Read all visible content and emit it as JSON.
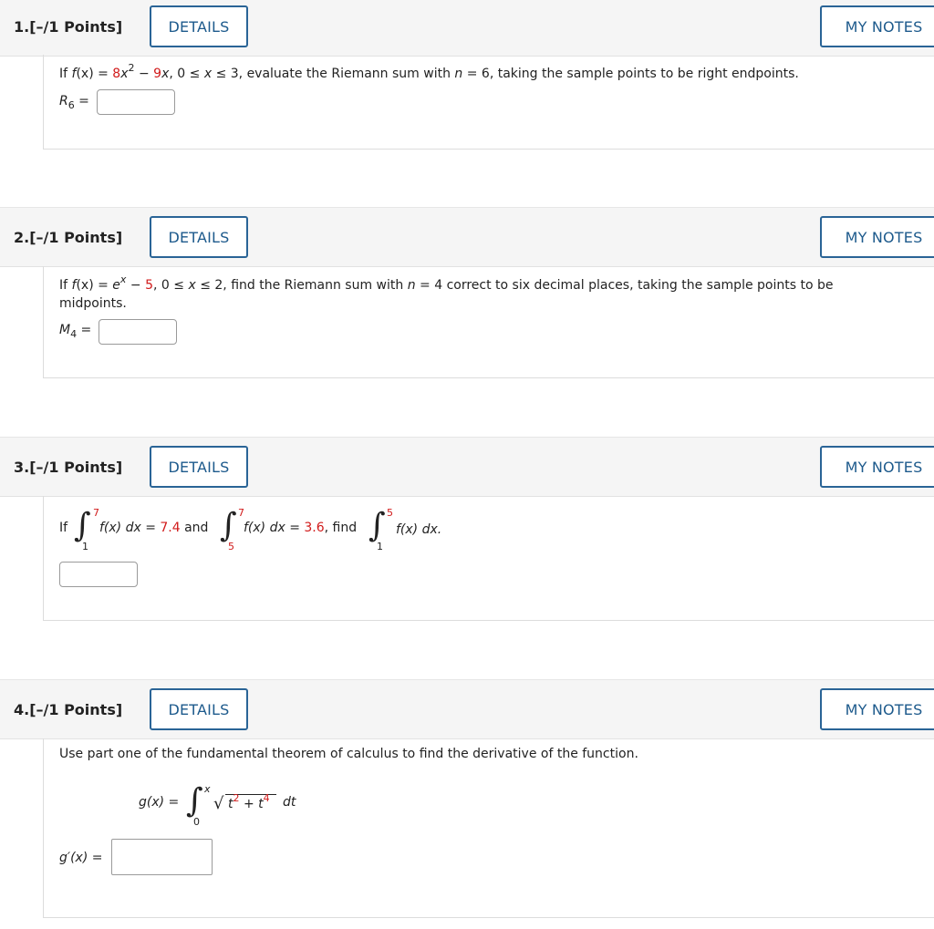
{
  "questions": [
    {
      "number": "1.",
      "points": "[–/1 Points]",
      "details_label": "DETAILS",
      "notes_label": "MY NOTES"
    },
    {
      "number": "2.",
      "points": "[–/1 Points]",
      "details_label": "DETAILS",
      "notes_label": "MY NOTES"
    },
    {
      "number": "3.",
      "points": "[–/1 Points]",
      "details_label": "DETAILS",
      "notes_label": "MY NOTES"
    },
    {
      "number": "4.",
      "points": "[–/1 Points]",
      "details_label": "DETAILS",
      "notes_label": "MY NOTES"
    }
  ],
  "q1": {
    "prefix": "If ",
    "fx": "f",
    "fx_rest": "(x) = ",
    "coef1": "8",
    "x2": "x",
    "exp2": "2",
    "minus": " − ",
    "coef2": "9",
    "x": "x",
    "range_text": ", 0 ≤ ",
    "range_x": "x",
    "range_end": " ≤ 3, evaluate the Riemann sum with ",
    "n": "n",
    "n_val": " = 6, taking the sample points to be right endpoints.",
    "answer_label": "R",
    "answer_sub": "6",
    "answer_eq": " ="
  },
  "q2": {
    "prefix": "If ",
    "fx": "f",
    "fx_rest": "(x) = ",
    "e": "e",
    "exp": "x",
    "minus": " − ",
    "const": "5",
    "range_text": ", 0 ≤ ",
    "range_x": "x",
    "range_end": " ≤ 2, find the Riemann sum with ",
    "n": "n",
    "n_val": " = 4 correct to six decimal places, taking the sample points to be",
    "line2": "midpoints.",
    "answer_label": "M",
    "answer_sub": "4",
    "answer_eq": " ="
  },
  "q3": {
    "if": "If",
    "int1_upper": "7",
    "int1_lower": "1",
    "int1_body": "f(x) dx = ",
    "int1_val": "7.4",
    "and": " and",
    "int2_upper": "7",
    "int2_lower": "5",
    "int2_body": "f(x) dx = ",
    "int2_val": "3.6",
    "find": ", find",
    "int3_upper": "5",
    "int3_lower": "1",
    "int3_body": "f(x) dx."
  },
  "q4": {
    "instruction": "Use part one of the fundamental theorem of calculus to find the derivative of the function.",
    "g_label": "g(x) =",
    "upper": "x",
    "lower": "0",
    "t": "t",
    "t_exp": "2",
    "plus": " + ",
    "t2": "t",
    "t2_exp": "4",
    "dt": "dt",
    "answer_label": "g′(x) ="
  },
  "colors": {
    "accent": "#1d5a8c",
    "highlight": "#d11a1a",
    "header_bg": "#f5f5f5"
  }
}
